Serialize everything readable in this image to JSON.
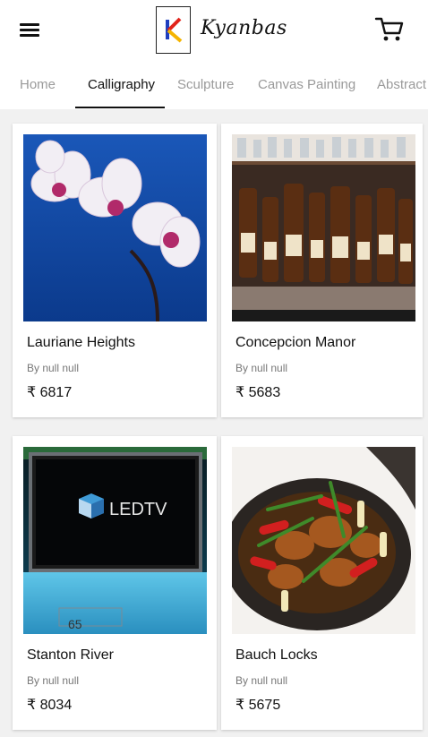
{
  "header": {
    "menu_icon": "hamburger-menu-icon",
    "logo_text": "Kyanbas",
    "cart_icon": "shopping-cart-icon"
  },
  "tabs": [
    {
      "label": "Home",
      "active": false
    },
    {
      "label": "Calligraphy",
      "active": true
    },
    {
      "label": "Sculpture",
      "active": false
    },
    {
      "label": "Canvas Painting",
      "active": false
    },
    {
      "label": "Abstract",
      "active": false
    }
  ],
  "products": [
    {
      "title": "Lauriane Heights",
      "artist": "By null null",
      "price": "₹ 6817",
      "image": "orchid-flowers"
    },
    {
      "title": "Concepcion Manor",
      "artist": "By null null",
      "price": "₹ 5683",
      "image": "bottles-on-shelf"
    },
    {
      "title": "Stanton River",
      "artist": "By null null",
      "price": "₹ 8034",
      "image": "led-tv"
    },
    {
      "title": "Bauch Locks",
      "artist": "By null null",
      "price": "₹ 5675",
      "image": "food-in-pot"
    }
  ],
  "images": {
    "led_text": "LEDTV",
    "tv_size": "65"
  },
  "colors": {
    "header_bg": "#ffffff",
    "page_bg": "#f1f1f1",
    "active_tab": "#111111",
    "inactive_tab": "#9a9a9a"
  }
}
